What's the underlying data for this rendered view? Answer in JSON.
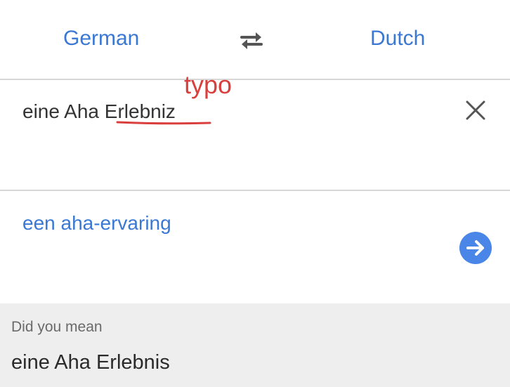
{
  "languages": {
    "source": "German",
    "target": "Dutch",
    "swap_icon": "swap-arrows-icon"
  },
  "annotation": {
    "text": "typo",
    "color": "#d9403d"
  },
  "input": {
    "value": "eine Aha Erlebniz",
    "clear_icon": "close-icon"
  },
  "translation": {
    "value": "een aha-ervaring",
    "go_icon": "arrow-right-icon"
  },
  "suggestion": {
    "label": "Did you mean",
    "value": "eine Aha Erlebnis"
  },
  "colors": {
    "accent": "#3a78d4",
    "button": "#4a86e8",
    "suggestion_bg": "#eeeeee"
  }
}
